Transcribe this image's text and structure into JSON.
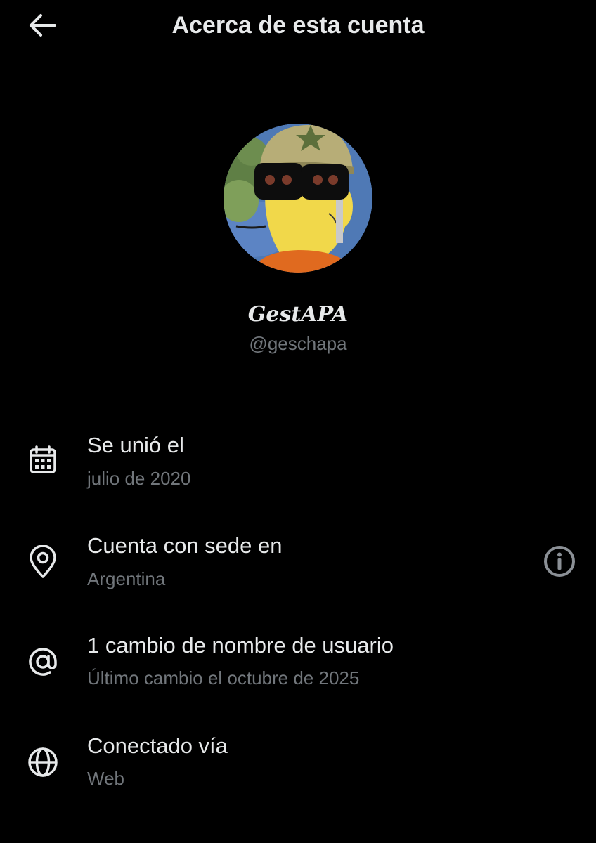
{
  "header": {
    "title": "Acerca de esta cuenta",
    "back_icon": "arrow-left-icon"
  },
  "profile": {
    "display_name": "GestAPA",
    "handle": "@geschapa",
    "avatar": "cartoon-avatar-with-helmet-and-sunglasses"
  },
  "details": [
    {
      "icon": "calendar-icon",
      "title": "Se unió el",
      "subtitle": "julio de 2020"
    },
    {
      "icon": "location-pin-icon",
      "title": "Cuenta con sede en",
      "subtitle": "Argentina",
      "action_icon": "info-icon"
    },
    {
      "icon": "at-sign-icon",
      "title": "1 cambio de nombre de usuario",
      "subtitle": "Último cambio el octubre de 2025"
    },
    {
      "icon": "globe-icon",
      "title": "Conectado vía",
      "subtitle": "Web"
    }
  ],
  "colors": {
    "background": "#000000",
    "primary_text": "#e7e9ea",
    "secondary_text": "#71767b"
  }
}
